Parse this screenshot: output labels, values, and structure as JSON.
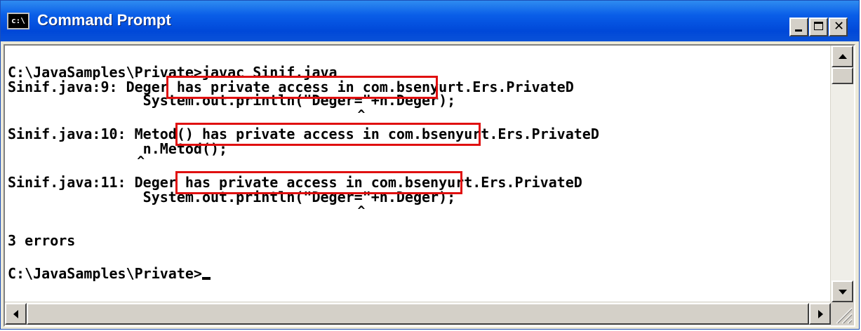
{
  "window": {
    "title": "Command Prompt",
    "icon": "console-icon",
    "icon_text": "c:\\"
  },
  "console": {
    "lines": [
      "C:\\JavaSamples\\Private>javac Sinif.java",
      "Sinif.java:9: Deger has private access in com.bsenyurt.Ers.PrivateD",
      "                System.out.println(\"Deger=\"+n.Deger);",
      "                                              ^",
      "",
      "Sinif.java:10: Metod() has private access in com.bsenyurt.Ers.PrivateD",
      "                n.Metod();",
      "                 ^",
      "",
      "Sinif.java:11: Deger has private access in com.bsenyurt.Ers.PrivateD",
      "                System.out.println(\"Deger=\"+n.Deger);",
      "                                              ^",
      "",
      "3 errors",
      "",
      "C:\\JavaSamples\\Private>"
    ],
    "highlight_color": "#e01010"
  },
  "icons": {
    "minimize": "minimize-icon",
    "maximize": "maximize-icon",
    "close": "close-icon",
    "scroll_up": "scroll-up-arrow-icon",
    "scroll_down": "scroll-down-arrow-icon",
    "scroll_left": "scroll-left-arrow-icon",
    "scroll_right": "scroll-right-arrow-icon"
  },
  "colors": {
    "titlebar": "#0a5ee8",
    "console_bg": "#ffffff",
    "console_text": "#000000"
  }
}
